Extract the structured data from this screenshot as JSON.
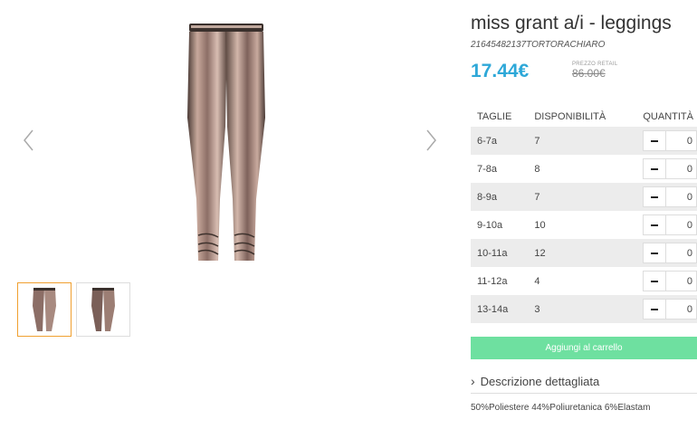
{
  "product": {
    "title": "miss grant a/i - leggings",
    "sku": "21645482137TORTORACHIARO",
    "price": "17.44€",
    "retail_label": "PREZZO RETAIL",
    "retail_price": "86.00€"
  },
  "table": {
    "headers": {
      "size": "TAGLIE",
      "availability": "DISPONIBILITÀ",
      "quantity": "QUANTITÀ"
    },
    "rows": [
      {
        "size": "6-7a",
        "availability": "7",
        "quantity": "0"
      },
      {
        "size": "7-8a",
        "availability": "8",
        "quantity": "0"
      },
      {
        "size": "8-9a",
        "availability": "7",
        "quantity": "0"
      },
      {
        "size": "9-10a",
        "availability": "10",
        "quantity": "0"
      },
      {
        "size": "10-11a",
        "availability": "12",
        "quantity": "0"
      },
      {
        "size": "11-12a",
        "availability": "4",
        "quantity": "0"
      },
      {
        "size": "13-14a",
        "availability": "3",
        "quantity": "0"
      }
    ]
  },
  "actions": {
    "add_to_cart": "Aggiungi al carrello"
  },
  "description": {
    "toggle_label": "Descrizione dettagliata",
    "chevron": "›",
    "composition": "50%Poliestere 44%Poliuretanica 6%Elastam"
  },
  "icons": {
    "prev": "chevron-left-icon",
    "next": "chevron-right-icon",
    "minus": "minus-icon"
  },
  "colors": {
    "price": "#2ea8d8",
    "add_button": "#6ee0a0",
    "thumb_active_border": "#f0a030",
    "row_shade": "#ececec"
  }
}
